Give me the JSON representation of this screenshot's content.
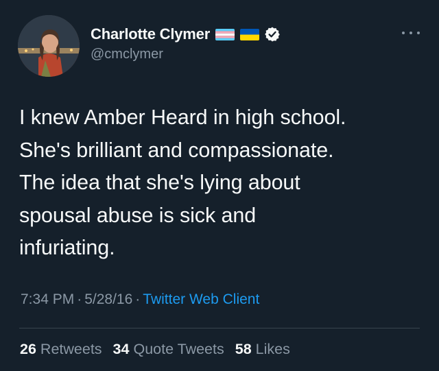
{
  "user": {
    "display_name": "Charlotte Clymer",
    "handle": "@cmclymer",
    "avatar": "profile-photo",
    "flags": [
      "transgender-flag",
      "ukraine-flag"
    ],
    "verified": true
  },
  "icons": {
    "more": "more-dots-icon",
    "verified": "verified-badge-icon"
  },
  "tweet": {
    "text": "I knew Amber Heard in high school.\nShe's brilliant and compassionate.\nThe idea that she's lying about\nspousal abuse is sick and\ninfuriating."
  },
  "meta": {
    "time": "7:34 PM",
    "separator": "·",
    "date": "5/28/16",
    "client": "Twitter Web Client"
  },
  "stats": {
    "retweets_count": "26",
    "retweets_label": "Retweets",
    "quotes_count": "34",
    "quotes_label": "Quote Tweets",
    "likes_count": "58",
    "likes_label": "Likes"
  },
  "colors": {
    "background": "#15202b",
    "text": "#f7f9f9",
    "secondary": "#8b98a5",
    "accent": "#1d9bf0"
  }
}
